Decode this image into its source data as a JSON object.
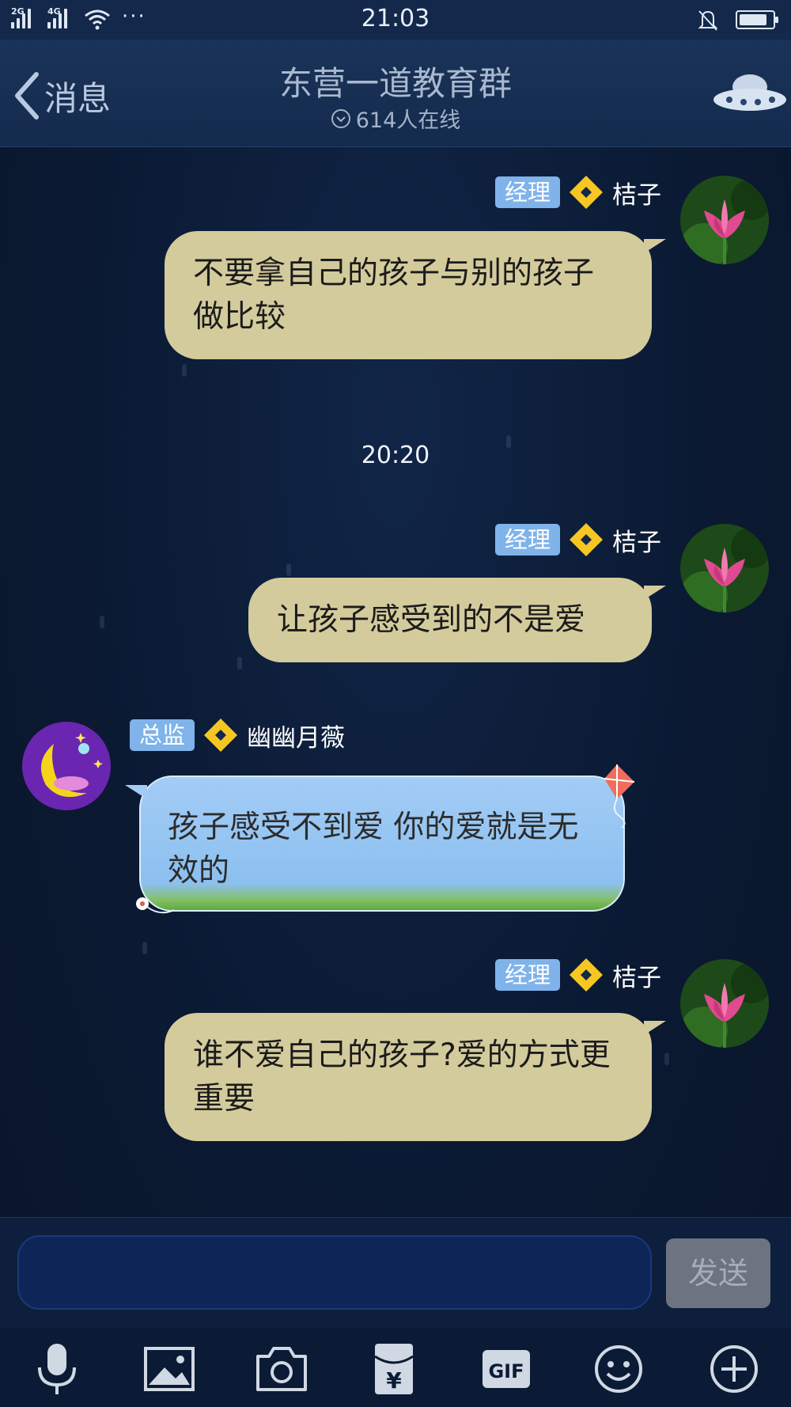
{
  "status_bar": {
    "time": "21:03",
    "network_1": "2G",
    "network_2": "4G",
    "more": "···",
    "battery_level": 0.85
  },
  "header": {
    "back_label": "消息",
    "title": "东营一道教育群",
    "online_text": "614人在线"
  },
  "messages": [
    {
      "role": "经理",
      "nick": "桔子",
      "text": "不要拿自己的孩子与别的孩子做比较",
      "side": "right"
    },
    {
      "role": "经理",
      "nick": "桔子",
      "text": "让孩子感受到的不是爱",
      "side": "right"
    },
    {
      "role": "总监",
      "nick": "幽幽月薇",
      "text": "孩子感受不到爱 你的爱就是无效的",
      "side": "left"
    },
    {
      "role": "经理",
      "nick": "桔子",
      "text": "谁不爱自己的孩子?爱的方式更重要",
      "side": "right"
    }
  ],
  "timestamp": "20:20",
  "input": {
    "value": "",
    "send_label": "发送"
  },
  "toolbar": {
    "icons": [
      "microphone-icon",
      "image-icon",
      "camera-icon",
      "red-packet-icon",
      "gif-icon",
      "emoji-icon",
      "plus-icon"
    ],
    "gif_label": "GIF",
    "yuan_label": "¥"
  },
  "colors": {
    "background": "#0b1a33",
    "right_bubble": "#d4cb9c",
    "left_bubble": "#a3ccf5",
    "role_badge": "#7fb3ea",
    "send_button": "#6b7480"
  }
}
